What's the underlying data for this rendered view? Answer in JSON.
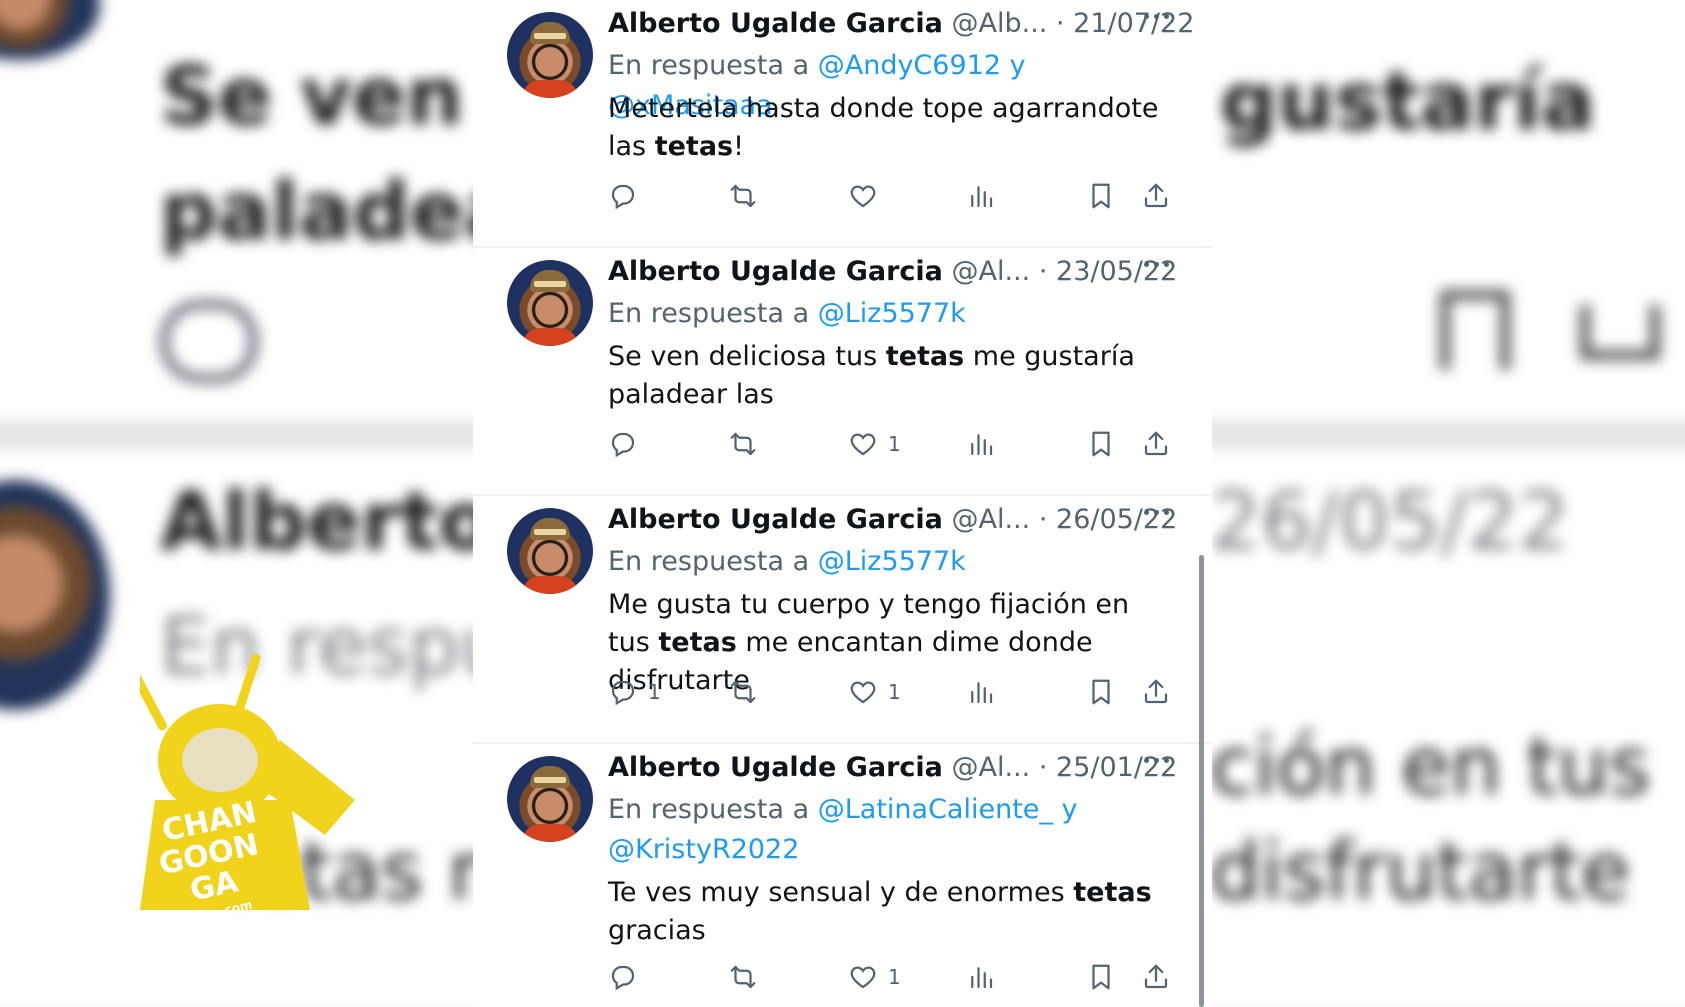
{
  "tweets": [
    {
      "name": "Alberto Ugalde Garcia",
      "handle": "@Alb...",
      "sep": "·",
      "date": "21/07/22",
      "reply_prefix": "En respuesta a",
      "mentions": [
        "@AndyC6912",
        "y",
        "@xMasitaaa"
      ],
      "text_parts": [
        "Metertela hasta donde tope agarrandote las ",
        "tetas",
        "!"
      ],
      "reply_count": "",
      "like_count": ""
    },
    {
      "name": "Alberto Ugalde Garcia",
      "handle": "@Al...",
      "sep": "·",
      "date": "23/05/22",
      "reply_prefix": "En respuesta a",
      "mentions": [
        "@Liz5577k"
      ],
      "text_parts": [
        "Se ven deliciosa tus ",
        "tetas",
        " me gustaría paladear las"
      ],
      "reply_count": "",
      "like_count": "1"
    },
    {
      "name": "Alberto Ugalde Garcia",
      "handle": "@Al...",
      "sep": "·",
      "date": "26/05/22",
      "reply_prefix": "En respuesta a",
      "mentions": [
        "@Liz5577k"
      ],
      "text_parts": [
        "Me gusta tu cuerpo y tengo fijación en tus ",
        "tetas",
        " me encantan dime donde disfrutarte"
      ],
      "reply_count": "1",
      "like_count": "1"
    },
    {
      "name": "Alberto Ugalde Garcia",
      "handle": "@Al...",
      "sep": "·",
      "date": "25/01/22",
      "reply_prefix": "En respuesta a",
      "mentions": [
        "@LatinaCaliente_",
        "y",
        "@KristyR2022"
      ],
      "text_parts": [
        "Te ves muy sensual y de enormes ",
        "tetas",
        " gracias"
      ],
      "reply_count": "",
      "like_count": "1"
    }
  ],
  "avatar_cap_text": "PUMALBERT",
  "watermark": {
    "lines": [
      "CHAN",
      "GOON",
      "GA"
    ],
    "suffix": ".com",
    "color": "#f2d31b"
  },
  "background": {
    "phrases": [
      "Se ven de",
      "paladear",
      "gustaría",
      "Alberto U",
      "26/05/22",
      "En respue",
      "ción en tus",
      "disfrutarte",
      "tetas me"
    ]
  },
  "colors": {
    "link": "#1d9bf0",
    "muted": "#536471",
    "text": "#0f1419"
  },
  "icons": [
    "reply-icon",
    "retweet-icon",
    "like-icon",
    "views-icon",
    "bookmark-icon",
    "share-icon",
    "more-icon"
  ]
}
